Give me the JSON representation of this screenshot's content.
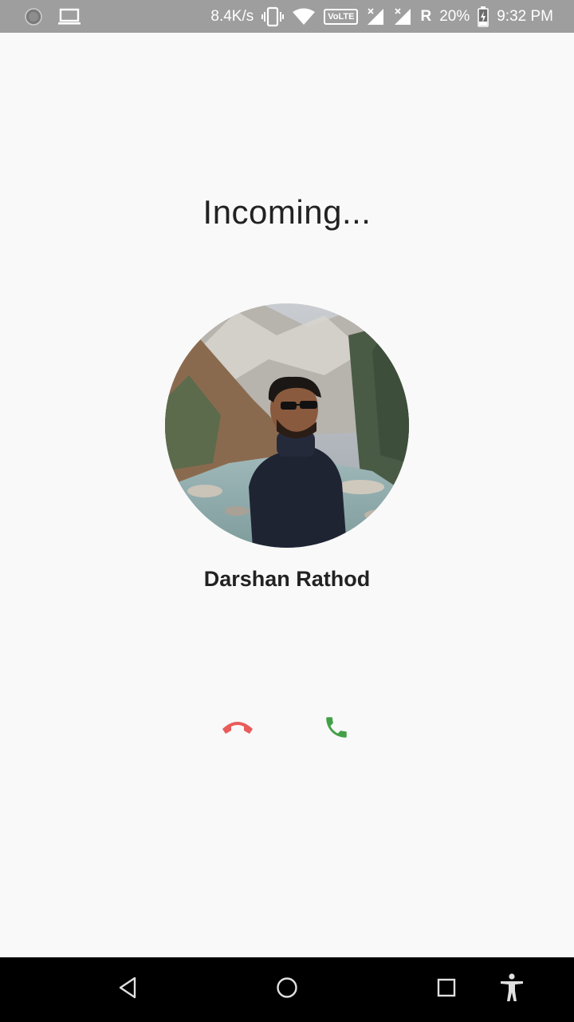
{
  "status_bar": {
    "network_speed": "8.4K/s",
    "volte_label": "VoLTE",
    "roaming": "R",
    "battery": "20%",
    "time": "9:32 PM"
  },
  "call": {
    "status_text": "Incoming...",
    "caller_name": "Darshan Rathod"
  },
  "colors": {
    "decline": "#e95c5c",
    "accept": "#43a047"
  },
  "icons": {
    "decline": "call-end-icon",
    "accept": "phone-icon",
    "nav_back": "back-icon",
    "nav_home": "home-icon",
    "nav_recents": "recents-icon",
    "accessibility": "accessibility-icon"
  }
}
